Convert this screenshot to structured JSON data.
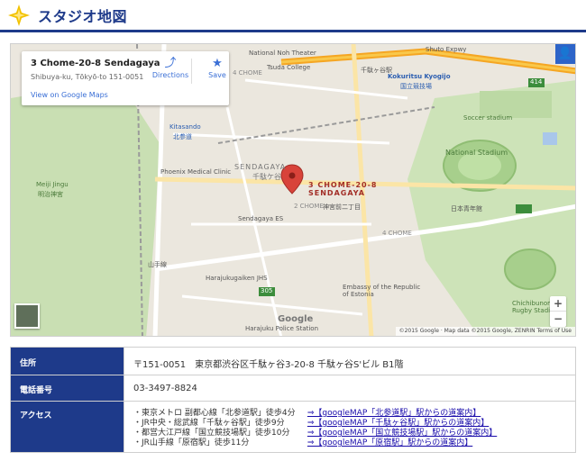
{
  "header": {
    "title": "スタジオ地図"
  },
  "map": {
    "card": {
      "address": "3 Chome-20-8 Sendagaya",
      "sub": "Shibuya-ku, Tōkyō-to 151-0051",
      "view_link": "View on Google Maps",
      "directions": "Directions",
      "save": "Save"
    },
    "pin_label_line1": "3 CHOME-20-8",
    "pin_label_line2": "SENDAGAYA",
    "labels": [
      "National Noh Theater",
      "Tsuda College",
      "千駄ヶ谷駅",
      "Kokuritsu Kyogijo",
      "国立競技場",
      "Soccer stadium",
      "National Stadium",
      "Meiji Jingu",
      "明治神宮",
      "Kitasando",
      "北参道",
      "Phoenix Medical Clinic",
      "SENDAGAYA",
      "千駄ケ谷",
      "Sendagaya ES",
      "Harajukugaiken JHS",
      "Harajuku Police Station",
      "Embassy of the Republic of Estonia",
      "日本青年館",
      "Chichibunomiya Rugby Stadium",
      "2 CHOME",
      "4 CHOME",
      "4 CHOME",
      "神宮前二丁目",
      "山手線",
      "414",
      "305",
      "Shuto Expwy"
    ],
    "attribution": "©2015 Google · Map data ©2015 Google, ZENRIN   Terms of Use",
    "google": "Google",
    "user_icon": "person-icon"
  },
  "table": {
    "address_label": "住所",
    "address_value": "〒151-0051　東京都渋谷区千駄ヶ谷3-20-8 千駄ヶ谷S'ビル B1階",
    "tel_label": "電話番号",
    "tel_value": "03-3497-8824",
    "access_label": "アクセス",
    "access": [
      {
        "station": "・東京メトロ 副都心線「北参道駅」徒歩4分",
        "link": "⇒【googleMAP「北参道駅」駅からの道案内】"
      },
      {
        "station": "・JR中央・総武線「千駄ヶ谷駅」徒歩9分",
        "link": "⇒【googleMAP「千駄ヶ谷駅」駅からの道案内】"
      },
      {
        "station": "・都営大江戸線「国立競技場駅」徒歩10分",
        "link": "⇒【googleMAP「国立競技場駅」駅からの道案内】"
      },
      {
        "station": "・JR山手線「原宿駅」徒歩11分",
        "link": "⇒【googleMAP「原宿駅」駅からの道案内】"
      }
    ]
  },
  "colors": {
    "accent": "#1e3a8a",
    "star": "#f2c200",
    "pin": "#d8433a",
    "link": "#1a0dab"
  }
}
